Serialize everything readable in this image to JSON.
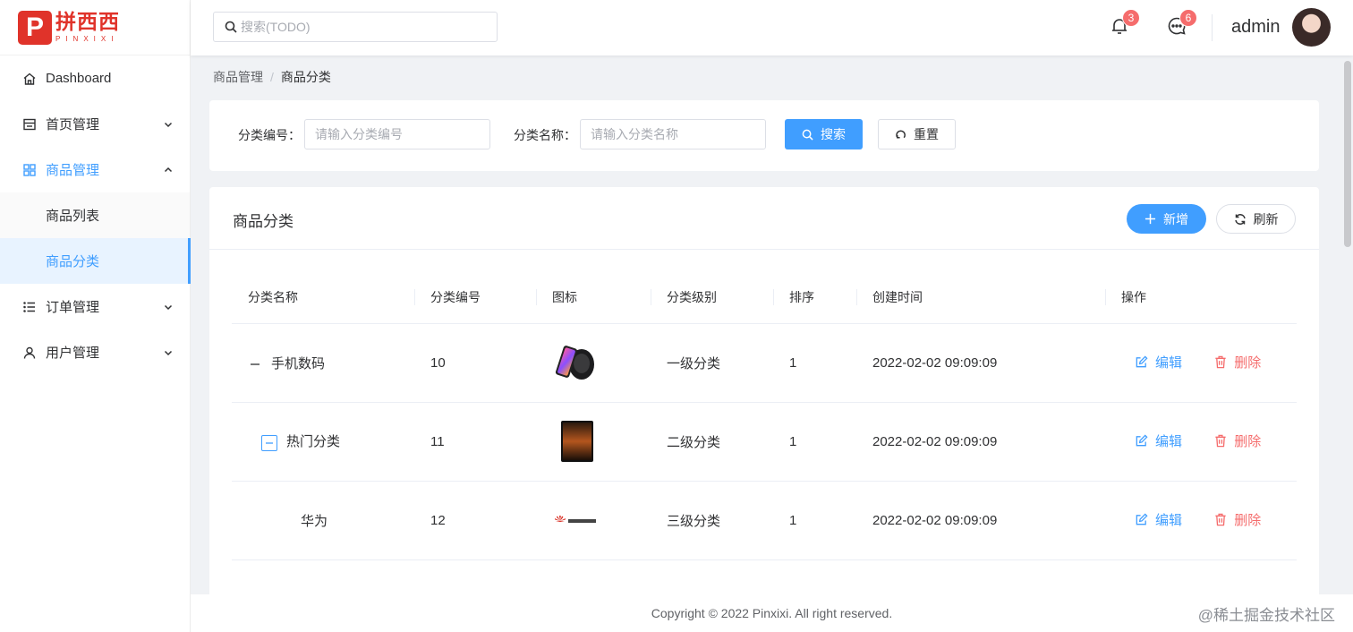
{
  "logo": {
    "mark": "P",
    "name_cn": "拼西西",
    "name_en": "PINXIXI"
  },
  "header": {
    "search_placeholder": "搜索(TODO)",
    "notifications_count": "3",
    "messages_count": "6",
    "username": "admin"
  },
  "sidebar": {
    "items": [
      {
        "label": "Dashboard"
      },
      {
        "label": "首页管理"
      },
      {
        "label": "商品管理"
      },
      {
        "label": "商品列表"
      },
      {
        "label": "商品分类"
      },
      {
        "label": "订单管理"
      },
      {
        "label": "用户管理"
      }
    ]
  },
  "breadcrumb": {
    "parent": "商品管理",
    "separator": "/",
    "current": "商品分类"
  },
  "filter": {
    "code_label": "分类编号：",
    "code_placeholder": "请输入分类编号",
    "name_label": "分类名称：",
    "name_placeholder": "请输入分类名称",
    "search_button": "搜索",
    "reset_button": "重置"
  },
  "table_card": {
    "title": "商品分类",
    "add_button": "新增",
    "refresh_button": "刷新",
    "columns": [
      "分类名称",
      "分类编号",
      "图标",
      "分类级别",
      "排序",
      "创建时间",
      "操作"
    ],
    "rows": [
      {
        "name": "手机数码",
        "code": "10",
        "icon": "phone-charger-image",
        "level": "一级分类",
        "sort": "1",
        "created": "2022-02-02 09:09:09",
        "edit": "编辑",
        "delete": "删除"
      },
      {
        "name": "热门分类",
        "code": "11",
        "icon": "smartphone-image",
        "level": "二级分类",
        "sort": "1",
        "created": "2022-02-02 09:09:09",
        "edit": "编辑",
        "delete": "删除"
      },
      {
        "name": "华为",
        "code": "12",
        "icon": "huawei-logo-image",
        "level": "三级分类",
        "sort": "1",
        "created": "2022-02-02 09:09:09",
        "edit": "编辑",
        "delete": "删除"
      }
    ]
  },
  "footer": {
    "copyright": "Copyright © 2022 Pinxixi. All right reserved."
  },
  "watermark": "@稀土掘金技术社区",
  "colors": {
    "primary": "#409eff",
    "danger": "#f56c6c",
    "brand": "#e0332a"
  }
}
